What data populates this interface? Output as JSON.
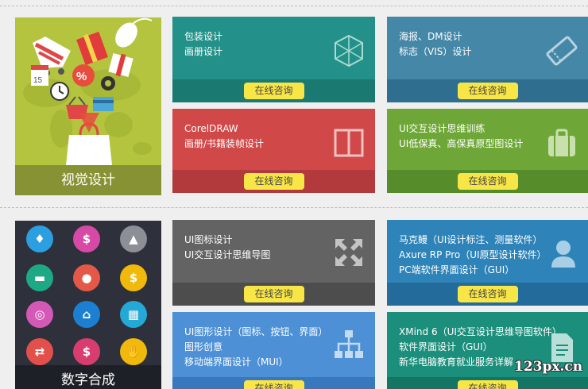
{
  "colors": {
    "teal": "#239189",
    "teal_bar": "#1a7a72",
    "steel": "#4587a7",
    "steel_bar": "#2f6e8e",
    "red": "#d04848",
    "red_bar": "#b23a3c",
    "green": "#6ea737",
    "green_bar": "#568c29",
    "gray": "#636363",
    "gray_bar": "#4d4d4d",
    "blue": "#2e83b8",
    "blue_bar": "#236b9b",
    "lightblue": "#4d90d6",
    "lightblue_bar": "#3a78bd",
    "teal2": "#1c8f7c",
    "teal2_bar": "#157564",
    "button": "#f8e646"
  },
  "visual_design": {
    "label": "视觉设计",
    "icons": [
      "shopping-cart-icon",
      "gift-icon",
      "mouse-icon",
      "calendar-icon",
      "percent-icon",
      "gear-icon",
      "clock-icon",
      "shopping-bag-icon",
      "world-map"
    ]
  },
  "digital_compositing": {
    "label": "数字合成",
    "icons": [
      "diamond-icon",
      "money-icon",
      "gold-bars-icon",
      "wallet-icon",
      "piggy-bank-icon",
      "money-bag-icon",
      "coins-icon",
      "house-icon",
      "chart-icon",
      "coin-exchange-icon",
      "dollar-transfer-icon",
      "handshake-icon"
    ]
  },
  "cards": [
    {
      "lines": [
        "包装设计",
        "画册设计"
      ],
      "button": "在线咨询",
      "icon": "hexagon-mesh-icon"
    },
    {
      "lines": [
        "海报、DM设计",
        "标志（VIS）设计"
      ],
      "button": "在线咨询",
      "icon": "ticket-icon"
    },
    {
      "lines": [
        "CorelDRAW",
        "画册/书籍装帧设计"
      ],
      "button": "在线咨询",
      "icon": "book-layout-icon"
    },
    {
      "lines": [
        "UI交互设计思维训练",
        "UI低保真、高保真原型图设计"
      ],
      "button": "在线咨询",
      "icon": "briefcase-icon"
    },
    {
      "lines": [
        "UI图标设计",
        "UI交互设计思维导图"
      ],
      "button": "在线咨询",
      "icon": "expand-arrows-icon"
    },
    {
      "lines": [
        "马克鳗（UI设计标注、测量软件）",
        "Axure RP Pro（UI原型设计软件）",
        "PC端软件界面设计（GUI）"
      ],
      "button": "在线咨询",
      "icon": "user-icon"
    },
    {
      "lines": [
        "UI图形设计（图标、按钮、界面）",
        "图形创意",
        "移动端界面设计（MUI）"
      ],
      "button": "在线咨询",
      "icon": "sitemap-icon"
    },
    {
      "lines": [
        "XMind 6（UI交互设计思维导图软件）",
        "软件界面设计（GUI）",
        "新华电脑教育就业服务详解"
      ],
      "button": "在线咨询",
      "icon": "document-icon"
    }
  ],
  "watermark": "123px.cn"
}
